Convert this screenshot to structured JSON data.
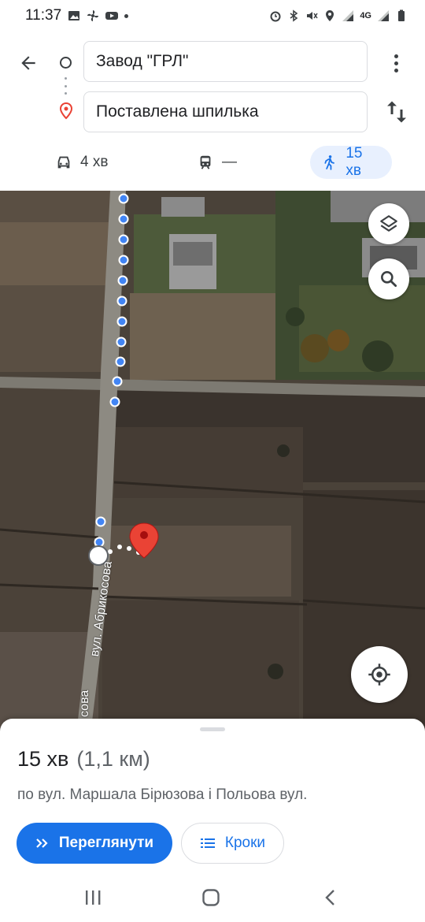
{
  "status_bar": {
    "time": "11:37",
    "network": "4G"
  },
  "directions": {
    "origin": "Завод \"ГРЛ\"",
    "destination": "Поставлена шпилька"
  },
  "modes": {
    "drive": "4 хв",
    "transit": "—",
    "walk": "15 хв"
  },
  "map": {
    "street_label": "вул. Абрикосова",
    "street_label_partial": "сова"
  },
  "route": {
    "duration": "15 хв",
    "distance": "(1,1 км)",
    "via": "по вул. Маршала Бірюзова і Польова вул.",
    "preview_label": "Переглянути",
    "steps_label": "Кроки"
  },
  "colors": {
    "accent": "#1a73e8",
    "walk_chip_bg": "#e8f0fe",
    "pin": "#ea4335"
  },
  "icons": [
    "back-arrow-icon",
    "origin-circle-icon",
    "destination-pin-icon",
    "more-vert-icon",
    "swap-icon",
    "car-icon",
    "train-icon",
    "walk-icon",
    "layers-icon",
    "search-icon",
    "my-location-icon",
    "double-chevron-icon",
    "list-icon",
    "recent-apps-icon",
    "home-icon",
    "nav-back-icon"
  ]
}
